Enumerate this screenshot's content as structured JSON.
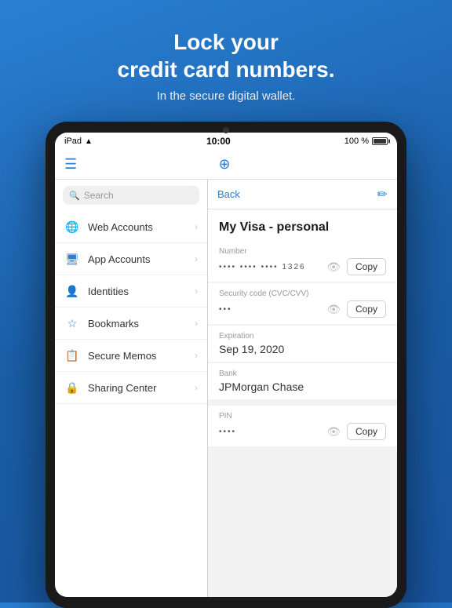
{
  "hero": {
    "title_line1": "Lock your",
    "title_line2": "credit card numbers.",
    "subtitle": "In the secure digital wallet."
  },
  "ipad": {
    "status_bar": {
      "device": "iPad",
      "wifi": "wifi",
      "time": "10:00",
      "battery": "100 %"
    },
    "nav": {
      "menu_icon": "☰",
      "add_icon": "⊕"
    },
    "sidebar": {
      "search_placeholder": "Search",
      "items": [
        {
          "id": "web-accounts",
          "icon": "🌐",
          "label": "Web Accounts"
        },
        {
          "id": "app-accounts",
          "icon": "🖥",
          "label": "App Accounts"
        },
        {
          "id": "identities",
          "icon": "👤",
          "label": "Identities"
        },
        {
          "id": "bookmarks",
          "icon": "☆",
          "label": "Bookmarks"
        },
        {
          "id": "secure-memos",
          "icon": "📋",
          "label": "Secure Memos"
        },
        {
          "id": "sharing-center",
          "icon": "🔒",
          "label": "Sharing Center"
        }
      ]
    },
    "detail": {
      "back_label": "Back",
      "edit_icon": "✏",
      "card_title": "My Visa - personal",
      "fields": [
        {
          "id": "number",
          "label": "Number",
          "value": "•••• •••• •••• 1326",
          "masked": true,
          "has_copy": true,
          "copy_label": "Copy"
        },
        {
          "id": "security-code",
          "label": "Security code (CVC/CVV)",
          "value": "•••",
          "masked": true,
          "has_copy": true,
          "copy_label": "Copy"
        },
        {
          "id": "expiration",
          "label": "Expiration",
          "value": "Sep 19, 2020",
          "masked": false,
          "has_copy": false
        },
        {
          "id": "bank",
          "label": "Bank",
          "value": "JPMorgan Chase",
          "masked": false,
          "has_copy": false
        },
        {
          "id": "pin",
          "label": "PIN",
          "value": "••••",
          "masked": true,
          "has_copy": true,
          "copy_label": "Copy"
        }
      ]
    }
  }
}
